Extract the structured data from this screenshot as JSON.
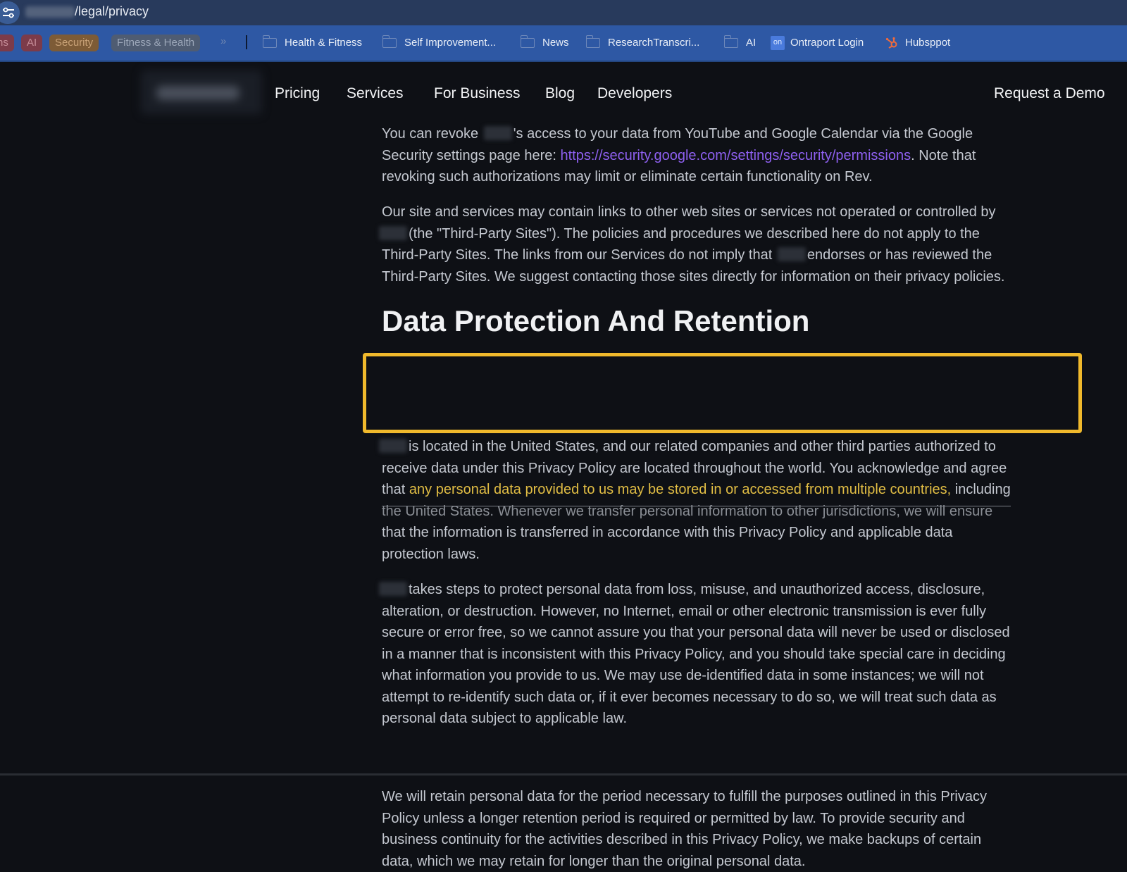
{
  "browser": {
    "url": "/legal/privacy"
  },
  "bookmarks": {
    "tags": {
      "partial": "ns",
      "ai": "AI",
      "security": "Security",
      "fitness": "Fitness & Health",
      "more": "»"
    },
    "items": [
      {
        "label": "Health & Fitness",
        "icon": "folder-icon"
      },
      {
        "label": "Self Improvement...",
        "icon": "folder-icon"
      },
      {
        "label": "News",
        "icon": "folder-icon"
      },
      {
        "label": "ResearchTranscri...",
        "icon": "folder-icon"
      },
      {
        "label": "AI",
        "icon": "folder-icon"
      },
      {
        "label": "Ontraport Login",
        "icon": "ontraport-logo",
        "logo_text": "on"
      },
      {
        "label": "Hubsppot",
        "icon": "hubspot-logo"
      }
    ]
  },
  "nav": {
    "links": [
      "Pricing",
      "Services",
      "For Business",
      "Blog",
      "Developers"
    ],
    "cta": "Request a Demo"
  },
  "article": {
    "p1": {
      "l1a": "You can revoke ",
      "l1b": "'s access to your data from YouTube and Google Calendar via the Google",
      "l2a": "Security settings page here: ",
      "l2link": "https://security.google.com/settings/security/permissions",
      "l2b": ". Note that",
      "l3": "revoking such authorizations may limit or eliminate certain functionality on Rev."
    },
    "p2": {
      "l1": "Our site and services may contain links to other web sites or services not operated or controlled by",
      "l2": "(the \"Third-Party Sites\"). The policies and procedures we described here do not apply to the",
      "l3a": "Third-Party Sites. The links from our Services do not imply that ",
      "l3b": "endorses or has reviewed the",
      "l4": "Third-Party Sites. We suggest contacting those sites directly for information on their privacy policies."
    },
    "section_title": "Data Protection And Retention",
    "p3": {
      "l1": "is located in the United States, and our related companies and other third parties authorized to",
      "l2": "receive data under this Privacy Policy are located throughout the world. You acknowledge and agree",
      "l3a": "that ",
      "l3hl": "any personal data provided to us may be stored in or accessed from multiple countries,",
      "l3b": " including",
      "l4": "the United States. Whenever we transfer personal information to other jurisdictions, we will ensure",
      "l5": "that the information is transferred in accordance with this Privacy Policy and applicable data",
      "l6": "protection laws."
    },
    "p4": [
      "takes steps to protect personal data from loss, misuse, and unauthorized access, disclosure,",
      "alteration, or destruction. However, no Internet, email or other electronic transmission is ever fully",
      "secure or error free, so we cannot assure you that your personal data will never be used or disclosed",
      "in a manner that is inconsistent with this Privacy Policy, and you should take special care in deciding",
      "what information you provide to us. We may use de-identified data in some instances; we will not",
      "attempt to re-identify such data or, if it ever becomes necessary to do so, we will treat such data as",
      "personal data subject to applicable law."
    ],
    "p5": [
      "We will retain personal data for the period necessary to fulfill the purposes outlined in this Privacy",
      "Policy unless a longer retention period is required or permitted by law. To provide security and",
      "business continuity for the activities described in this Privacy Policy, we make backups of certain",
      "data, which we may retain for longer than the original personal data."
    ]
  },
  "colors": {
    "highlight_border": "#f0b92c",
    "highlight_text": "#e1bd44",
    "link": "#8e60f0",
    "page_bg": "#0e1015",
    "bookmarks_bg": "#2e58a4"
  }
}
